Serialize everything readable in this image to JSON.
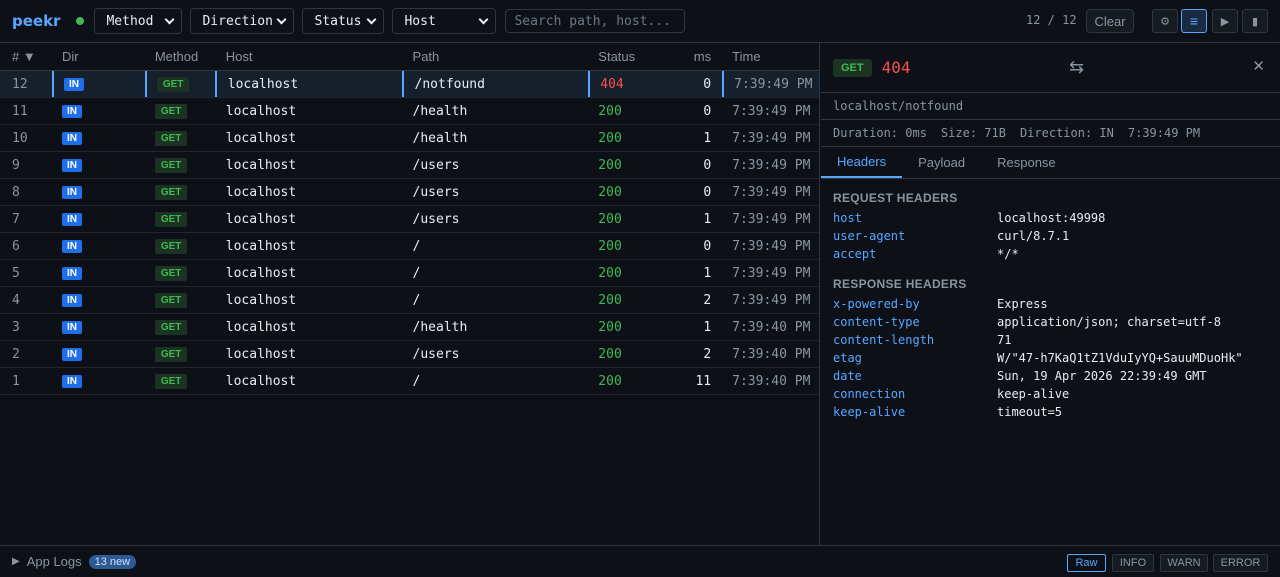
{
  "app": {
    "logo": "peekr"
  },
  "toolbar": {
    "filters": [
      {
        "label": "Method"
      },
      {
        "label": "Direction"
      },
      {
        "label": "Status"
      },
      {
        "label": "Host"
      }
    ],
    "search_placeholder": "Search path, host...",
    "counter": "12 / 12",
    "clear_label": "Clear",
    "icons": [
      "settings-icon",
      "list-view-icon",
      "play-icon",
      "pause-icon"
    ]
  },
  "table": {
    "headers": {
      "num": "# ▼",
      "dir": "Dir",
      "method": "Method",
      "host": "Host",
      "path": "Path",
      "status": "Status",
      "ms": "ms",
      "time": "Time"
    },
    "rows": [
      {
        "num": "12",
        "dir": "IN",
        "method": "GET",
        "host": "localhost",
        "path": "/notfound",
        "status": "404",
        "ms": "0",
        "time": "7:39:49 PM"
      },
      {
        "num": "11",
        "dir": "IN",
        "method": "GET",
        "host": "localhost",
        "path": "/health",
        "status": "200",
        "ms": "0",
        "time": "7:39:49 PM"
      },
      {
        "num": "10",
        "dir": "IN",
        "method": "GET",
        "host": "localhost",
        "path": "/health",
        "status": "200",
        "ms": "1",
        "time": "7:39:49 PM"
      },
      {
        "num": "9",
        "dir": "IN",
        "method": "GET",
        "host": "localhost",
        "path": "/users",
        "status": "200",
        "ms": "0",
        "time": "7:39:49 PM"
      },
      {
        "num": "8",
        "dir": "IN",
        "method": "GET",
        "host": "localhost",
        "path": "/users",
        "status": "200",
        "ms": "0",
        "time": "7:39:49 PM"
      },
      {
        "num": "7",
        "dir": "IN",
        "method": "GET",
        "host": "localhost",
        "path": "/users",
        "status": "200",
        "ms": "1",
        "time": "7:39:49 PM"
      },
      {
        "num": "6",
        "dir": "IN",
        "method": "GET",
        "host": "localhost",
        "path": "/",
        "status": "200",
        "ms": "0",
        "time": "7:39:49 PM"
      },
      {
        "num": "5",
        "dir": "IN",
        "method": "GET",
        "host": "localhost",
        "path": "/",
        "status": "200",
        "ms": "1",
        "time": "7:39:49 PM"
      },
      {
        "num": "4",
        "dir": "IN",
        "method": "GET",
        "host": "localhost",
        "path": "/",
        "status": "200",
        "ms": "2",
        "time": "7:39:49 PM"
      },
      {
        "num": "3",
        "dir": "IN",
        "method": "GET",
        "host": "localhost",
        "path": "/health",
        "status": "200",
        "ms": "1",
        "time": "7:39:40 PM"
      },
      {
        "num": "2",
        "dir": "IN",
        "method": "GET",
        "host": "localhost",
        "path": "/users",
        "status": "200",
        "ms": "2",
        "time": "7:39:40 PM"
      },
      {
        "num": "1",
        "dir": "IN",
        "method": "GET",
        "host": "localhost",
        "path": "/",
        "status": "200",
        "ms": "11",
        "time": "7:39:40 PM"
      }
    ]
  },
  "detail": {
    "method": "GET",
    "status": "404",
    "url": "localhost/notfound",
    "duration": "Duration: 0ms",
    "size": "Size: 71B",
    "direction": "Direction: IN",
    "time": "7:39:49 PM",
    "tabs": [
      "Headers",
      "Payload",
      "Response"
    ],
    "request_title": "REQUEST HEADERS",
    "request_headers": [
      {
        "k": "host",
        "v": "localhost:49998"
      },
      {
        "k": "user-agent",
        "v": "curl/8.7.1"
      },
      {
        "k": "accept",
        "v": "*/*"
      }
    ],
    "response_title": "RESPONSE HEADERS",
    "response_headers": [
      {
        "k": "x-powered-by",
        "v": "Express"
      },
      {
        "k": "content-type",
        "v": "application/json; charset=utf-8"
      },
      {
        "k": "content-length",
        "v": "71"
      },
      {
        "k": "etag",
        "v": "W/\"47-h7KaQ1tZ1VduIyYQ+SauuMDuoHk\""
      },
      {
        "k": "date",
        "v": "Sun, 19 Apr 2026 22:39:49 GMT"
      },
      {
        "k": "connection",
        "v": "keep-alive"
      },
      {
        "k": "keep-alive",
        "v": "timeout=5"
      }
    ]
  },
  "footer": {
    "label": "App Logs",
    "new_badge": "13 new",
    "levels": [
      "Raw",
      "INFO",
      "WARN",
      "ERROR"
    ]
  },
  "colors": {
    "accent": "#58a6ff",
    "ok": "#3fb950",
    "error": "#f85149",
    "background": "#0d1117"
  }
}
